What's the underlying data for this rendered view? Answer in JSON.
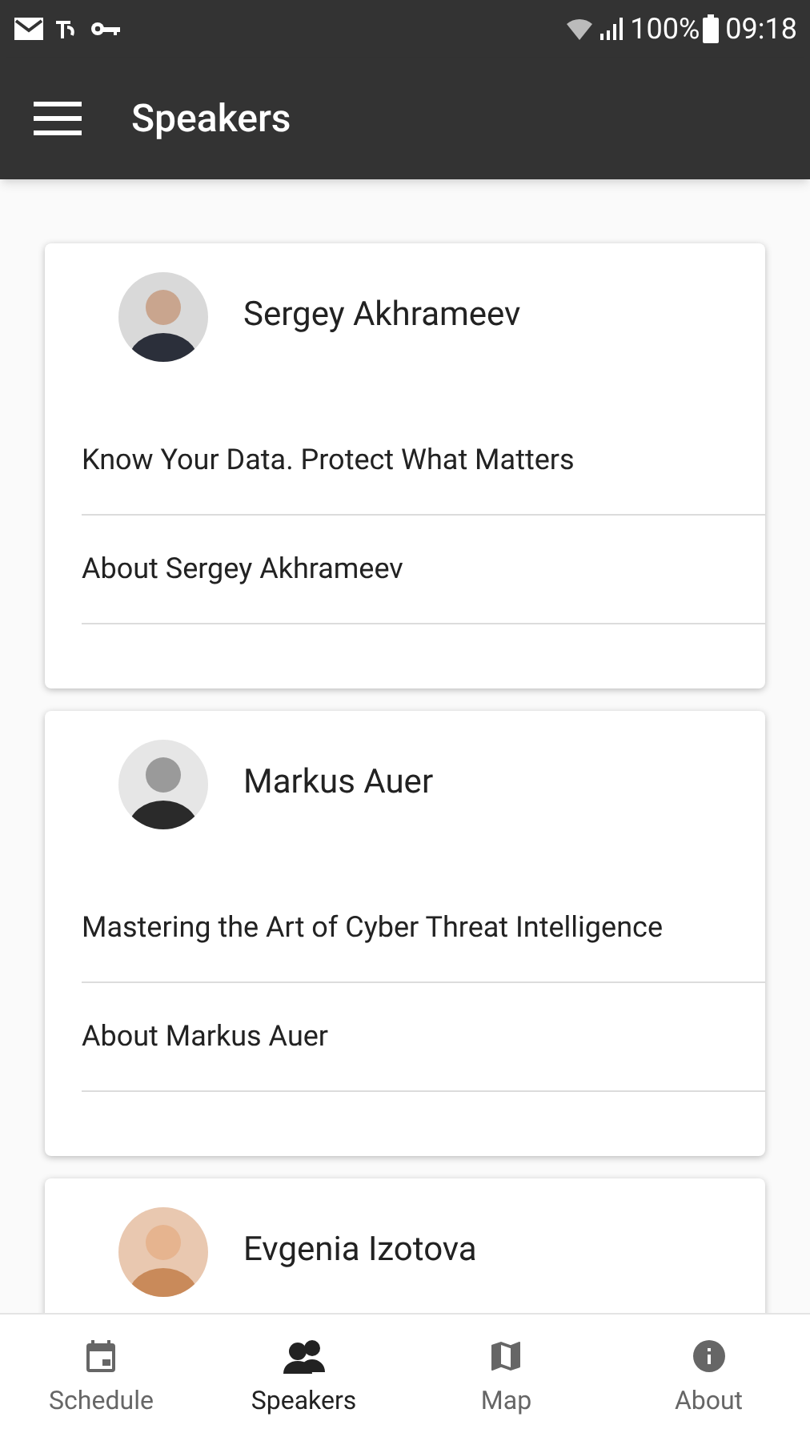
{
  "status_bar": {
    "battery": "100%",
    "time": "09:18"
  },
  "app_bar": {
    "title": "Speakers"
  },
  "speakers": [
    {
      "name": "Sergey Akhrameev",
      "talks": [
        "Know Your Data. Protect What Matters"
      ],
      "about": "About Sergey Akhrameev"
    },
    {
      "name": "Markus Auer",
      "talks": [
        "Mastering the Art of Cyber Threat Intelligence"
      ],
      "about": "About Markus Auer"
    },
    {
      "name": "Evgenia Izotova"
    }
  ],
  "bottom_nav": [
    {
      "label": "Schedule",
      "kind": "calendar",
      "selected": false
    },
    {
      "label": "Speakers",
      "kind": "people",
      "selected": true
    },
    {
      "label": "Map",
      "kind": "map",
      "selected": false
    },
    {
      "label": "About",
      "kind": "info",
      "selected": false
    }
  ]
}
